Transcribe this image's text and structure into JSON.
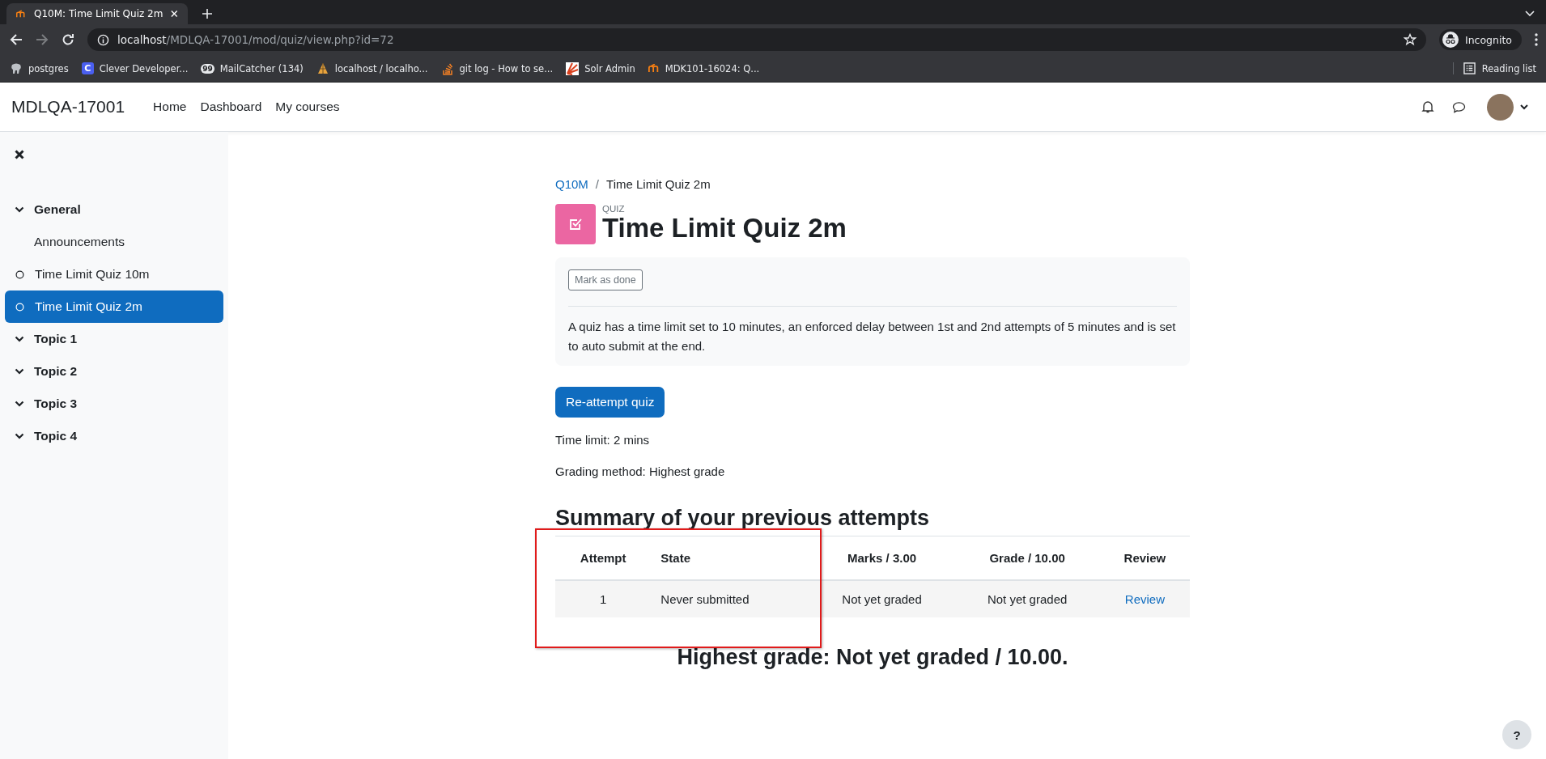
{
  "browser": {
    "tab": {
      "title": "Q10M: Time Limit Quiz 2m"
    },
    "url": {
      "host": "localhost",
      "path": "/MDLQA-17001/mod/quiz/view.php?id=72"
    },
    "profile": "Incognito",
    "bookmarks": [
      {
        "label": "postgres",
        "kind": "elephant"
      },
      {
        "label": "Clever Developer...",
        "kind": "letter",
        "glyph": "C"
      },
      {
        "label": "MailCatcher (134)",
        "kind": "badge",
        "glyph": "99"
      },
      {
        "label": "localhost / localho...",
        "kind": "sail"
      },
      {
        "label": "git log - How to se...",
        "kind": "stack"
      },
      {
        "label": "Solr Admin",
        "kind": "sun"
      },
      {
        "label": "MDK101-16024: Q...",
        "kind": "moodle"
      }
    ],
    "reading_list": "Reading list"
  },
  "navbar": {
    "brand": "MDLQA-17001",
    "links": [
      "Home",
      "Dashboard",
      "My courses"
    ]
  },
  "sidebar": {
    "items": [
      {
        "label": "General",
        "kind": "section",
        "expanded": true,
        "selected": false
      },
      {
        "label": "Announcements",
        "kind": "plain",
        "selected": false
      },
      {
        "label": "Time Limit Quiz 10m",
        "kind": "activity",
        "selected": false
      },
      {
        "label": "Time Limit Quiz 2m",
        "kind": "activity",
        "selected": true
      },
      {
        "label": "Topic 1",
        "kind": "section",
        "expanded": true,
        "selected": false
      },
      {
        "label": "Topic 2",
        "kind": "section",
        "expanded": true,
        "selected": false
      },
      {
        "label": "Topic 3",
        "kind": "section",
        "expanded": true,
        "selected": false
      },
      {
        "label": "Topic 4",
        "kind": "section",
        "expanded": true,
        "selected": false
      }
    ]
  },
  "breadcrumb": [
    {
      "label": "Q10M",
      "kind": "link"
    },
    {
      "label": "/",
      "kind": "separator"
    },
    {
      "label": "Time Limit Quiz 2m",
      "kind": "current"
    }
  ],
  "module": {
    "type": "QUIZ",
    "title": "Time Limit Quiz 2m"
  },
  "completion": {
    "button": "Mark as done",
    "description": "A quiz has a time limit set to 10 minutes, an enforced delay between 1st and 2nd attempts of 5 minutes and is set to auto submit at the end."
  },
  "primary_button": "Re-attempt quiz",
  "info": [
    "Time limit: 2 mins",
    "Grading method: Highest grade"
  ],
  "summary": {
    "heading": "Summary of your previous attempts",
    "columns": [
      {
        "label": "Attempt"
      },
      {
        "label": "State"
      },
      {
        "label": "Marks / 3.00"
      },
      {
        "label": "Grade / 10.00"
      },
      {
        "label": "Review"
      }
    ],
    "rows": [
      [
        {
          "text": "1",
          "kind": "text"
        },
        {
          "text": "Never submitted",
          "kind": "text"
        },
        {
          "text": "Not yet graded",
          "kind": "text"
        },
        {
          "text": "Not yet graded",
          "kind": "text"
        },
        {
          "text": "Review",
          "kind": "link"
        }
      ]
    ]
  },
  "highest_grade": "Highest grade: Not yet graded / 10.00.",
  "help_button": "?"
}
